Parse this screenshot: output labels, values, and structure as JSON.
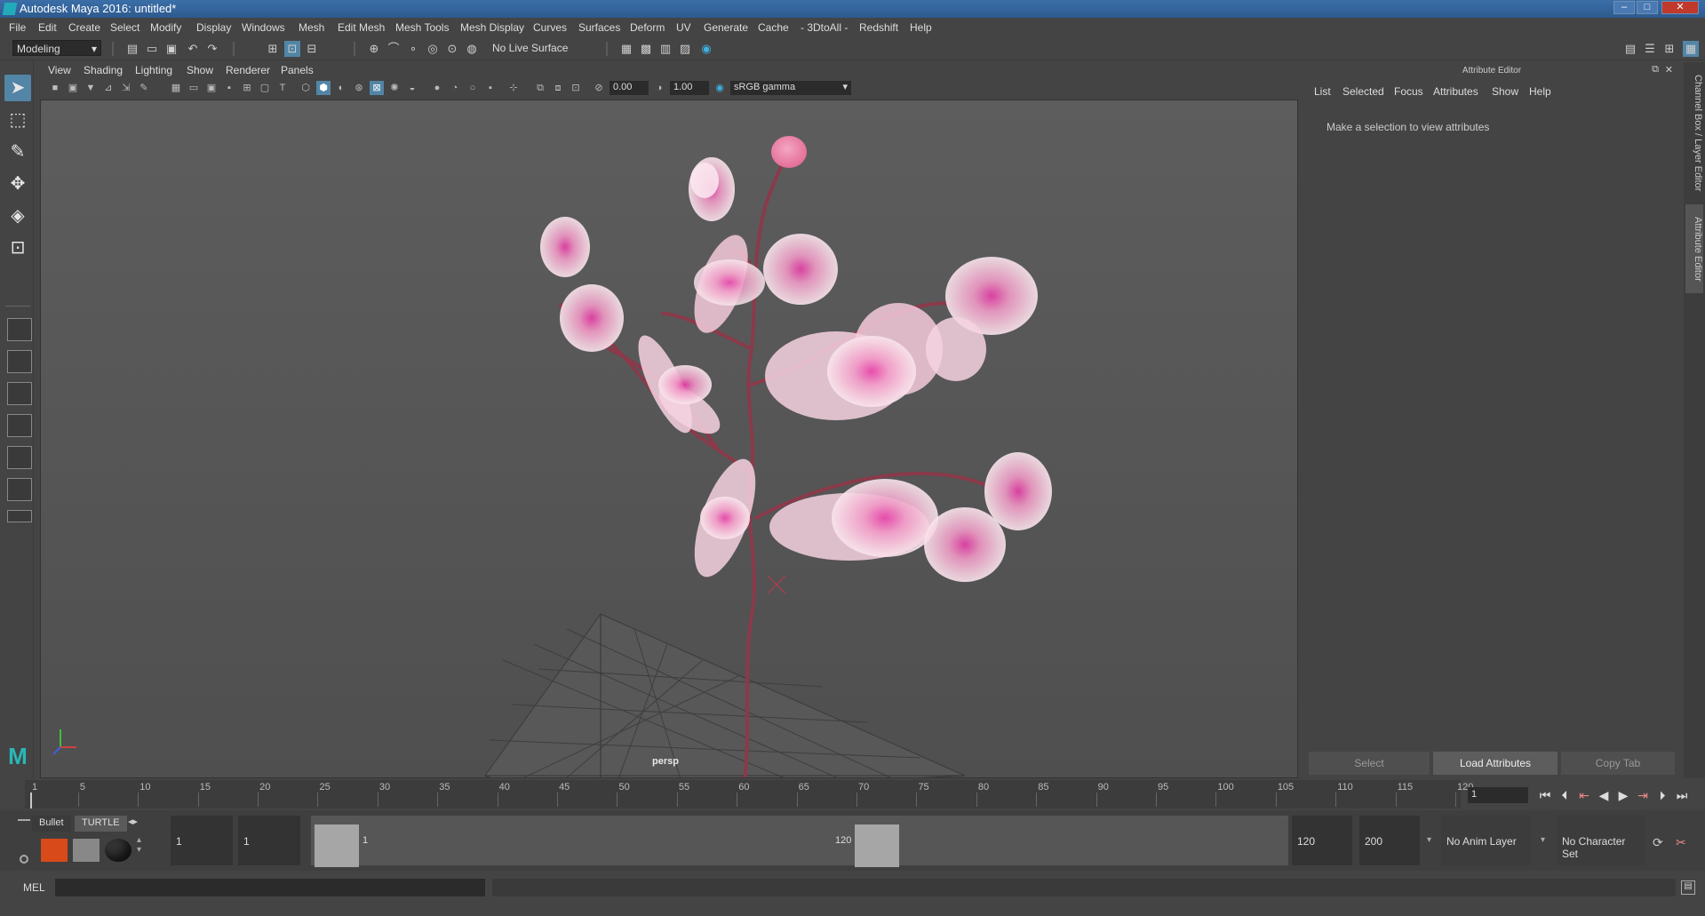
{
  "window": {
    "title": "Autodesk Maya 2016: untitled*",
    "minimize": "–",
    "maximize": "□",
    "close": "✕"
  },
  "menubar": [
    "File",
    "Edit",
    "Create",
    "Select",
    "Modify",
    "Display",
    "Windows",
    "Mesh",
    "Edit Mesh",
    "Mesh Tools",
    "Mesh Display",
    "Curves",
    "Surfaces",
    "Deform",
    "UV",
    "Generate",
    "Cache",
    "- 3DtoAll -",
    "Redshift",
    "Help"
  ],
  "status_line": {
    "mode": "Modeling",
    "live_surface": "No Live Surface"
  },
  "viewport": {
    "menu": [
      "View",
      "Shading",
      "Lighting",
      "Show",
      "Renderer",
      "Panels"
    ],
    "field_a": "0.00",
    "field_b": "1.00",
    "color_space": "sRGB gamma",
    "camera_label": "persp"
  },
  "attribute_editor": {
    "title": "Attribute Editor",
    "menu": [
      "List",
      "Selected",
      "Focus",
      "Attributes",
      "Show",
      "Help"
    ],
    "message": "Make a selection to view attributes",
    "buttons": {
      "select": "Select",
      "load": "Load Attributes",
      "copy": "Copy Tab"
    }
  },
  "side_tabs": {
    "channel_box": "Channel Box / Layer Editor",
    "attribute_editor": "Attribute Editor"
  },
  "timeline": {
    "ticks": [
      "1",
      "5",
      "10",
      "15",
      "20",
      "25",
      "30",
      "35",
      "40",
      "45",
      "50",
      "55",
      "60",
      "65",
      "70",
      "75",
      "80",
      "85",
      "90",
      "95",
      "100",
      "105",
      "110",
      "115",
      "120"
    ],
    "current_frame": "1"
  },
  "range": {
    "start": "1",
    "anim_start": "1",
    "range_start_label": "1",
    "range_end_label": "120",
    "end": "120",
    "anim_end": "200",
    "anim_layer": "No Anim Layer",
    "character_set": "No Character Set"
  },
  "shelf_tabs": [
    "Bullet",
    "TURTLE"
  ],
  "command_line": {
    "label": "MEL"
  },
  "colors": {
    "accent": "#5285a6",
    "petal": "#f4c6d8",
    "petal_center": "#e63fa8",
    "stem": "#8a3a4a",
    "bg": "#444444"
  }
}
